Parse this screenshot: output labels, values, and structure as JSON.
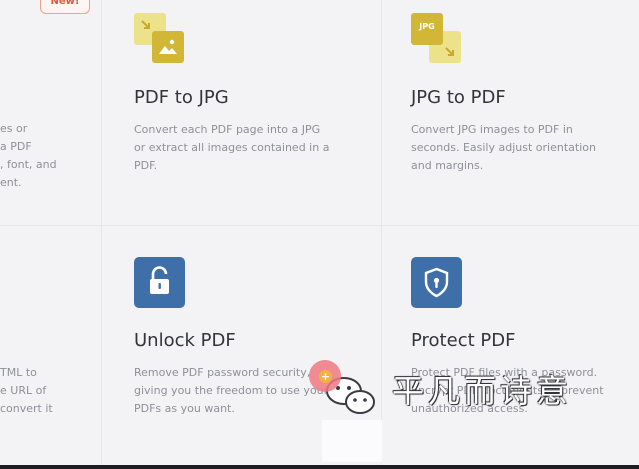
{
  "cards": {
    "pdf_to_jpg": {
      "title": "PDF to JPG",
      "description": "Convert each PDF page into a JPG\nor extract all images contained in a\nPDF."
    },
    "jpg_to_pdf": {
      "title": "JPG to PDF",
      "description": "Convert JPG images to PDF in\nseconds. Easily adjust orientation\nand margins.",
      "icon_label": "JPG"
    },
    "unlock_pdf": {
      "title": "Unlock PDF",
      "description": "Remove PDF password security,\ngiving you the freedom to use your\nPDFs as you want."
    },
    "protect_pdf": {
      "title": "Protect PDF",
      "description": "Protect PDF files with a password.\nEncrypt PDF documents to prevent\nunauthorized access."
    },
    "left_top_partial": {
      "badge": "New!",
      "description": "es or\na PDF\n, font, and\nent."
    },
    "left_bottom_partial": {
      "description": "TML to\ne URL of\nconvert it"
    }
  },
  "overlay": {
    "watermark_text": "平凡而诗意"
  },
  "colors": {
    "background": "#f3f3f6",
    "yellow_light": "#ece289",
    "yellow_dark": "#d2b737",
    "blue": "#3f6fa8",
    "badge_red": "#e4553b"
  },
  "icons": {
    "pdf_to_jpg": "image-arrow-icon",
    "jpg_to_pdf": "jpg-arrow-icon",
    "unlock_pdf": "unlock-icon",
    "protect_pdf": "shield-lock-icon"
  }
}
